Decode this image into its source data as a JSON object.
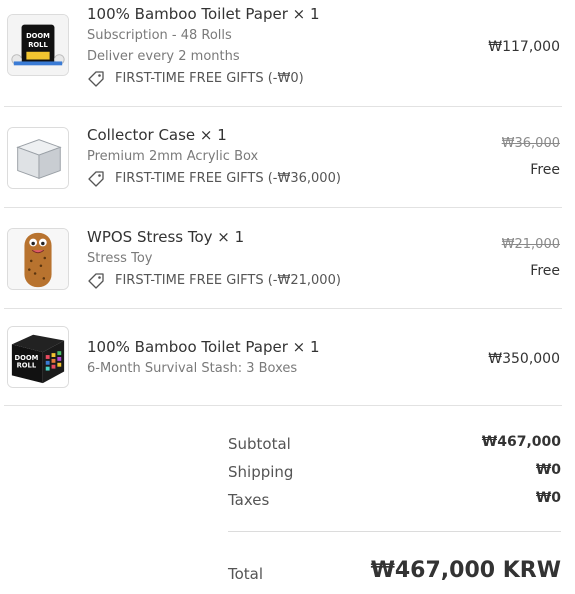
{
  "items": [
    {
      "title": "100% Bamboo Toilet Paper × 1",
      "sub1": "Subscription - 48 Rolls",
      "sub2": "Deliver every 2 months",
      "gift": "FIRST-TIME FREE GIFTS (-₩0)",
      "price": "₩117,000",
      "thumb_icon": "toilet-paper-box-icon"
    },
    {
      "title": "Collector Case × 1",
      "sub1": "Premium 2mm Acrylic Box",
      "gift": "FIRST-TIME FREE GIFTS (-₩36,000)",
      "original_price": "₩36,000",
      "price": "Free",
      "thumb_icon": "acrylic-cube-icon"
    },
    {
      "title": "WPOS Stress Toy × 1",
      "sub1": "Stress Toy",
      "gift": "FIRST-TIME FREE GIFTS (-₩21,000)",
      "original_price": "₩21,000",
      "price": "Free",
      "thumb_icon": "stress-toy-icon"
    },
    {
      "title": "100% Bamboo Toilet Paper × 1",
      "sub1": "6-Month Survival Stash: 3 Boxes",
      "price": "₩350,000",
      "thumb_icon": "doom-roll-cube-icon"
    }
  ],
  "summary": {
    "subtotal_label": "Subtotal",
    "subtotal_value": "₩467,000",
    "shipping_label": "Shipping",
    "shipping_value": "₩0",
    "taxes_label": "Taxes",
    "taxes_value": "₩0",
    "total_label": "Total",
    "total_value": "₩467,000 KRW"
  },
  "thumb_text": "DOOM ROLL",
  "colors": {
    "text": "#333333",
    "muted": "#7a7a7a",
    "divider": "#e2e2e2"
  }
}
